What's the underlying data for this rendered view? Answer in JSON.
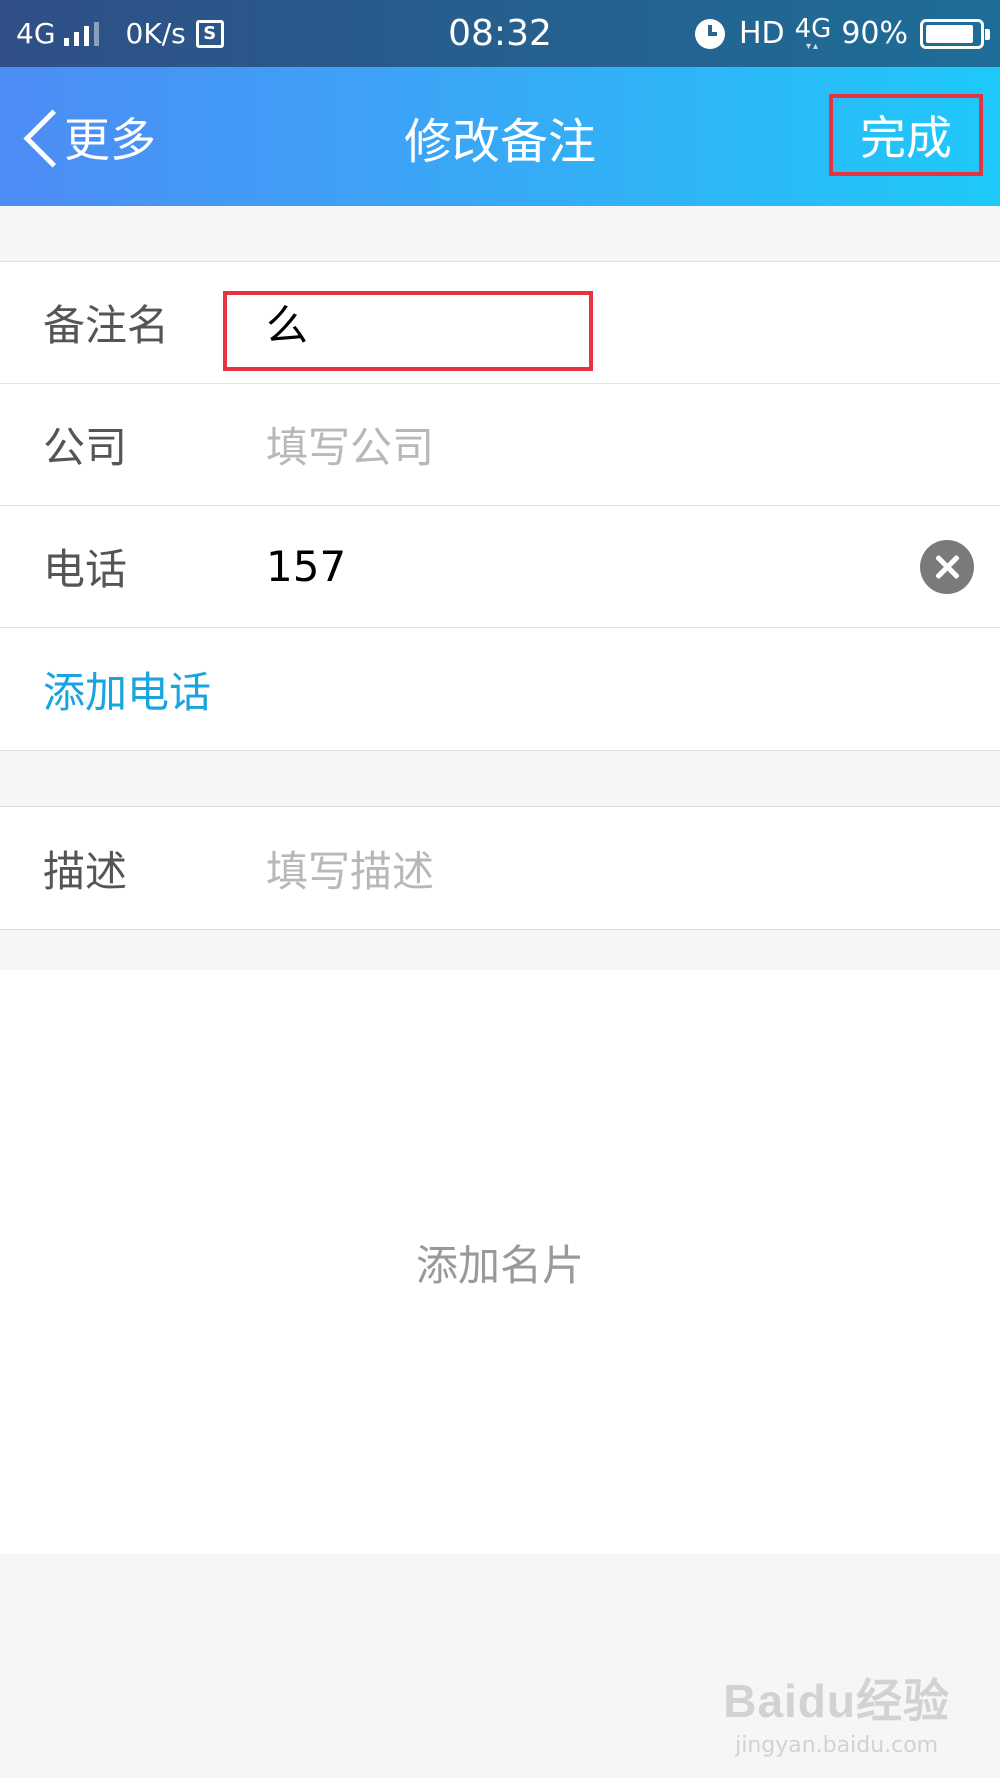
{
  "status_bar": {
    "network": "4G",
    "speed": "0K/s",
    "s_icon_letter": "S",
    "time": "08:32",
    "hd": "HD",
    "net_right": "4G",
    "battery_text": "90%",
    "battery_level": 0.9
  },
  "nav": {
    "back_label": "更多",
    "title": "修改备注",
    "done_label": "完成"
  },
  "form": {
    "remark": {
      "label": "备注名",
      "value": "么"
    },
    "company": {
      "label": "公司",
      "placeholder": "填写公司"
    },
    "phone": {
      "label": "电话",
      "value": "157"
    },
    "add_phone_label": "添加电话",
    "description": {
      "label": "描述",
      "placeholder": "填写描述"
    }
  },
  "card": {
    "label": "添加名片"
  },
  "watermark": {
    "logo": "Baidu经验",
    "url": "jingyan.baidu.com"
  },
  "colors": {
    "nav_gradient_start": "#4d8cf5",
    "nav_gradient_end": "#1ec9fa",
    "highlight_border": "#e53340",
    "link_blue": "#17a4df",
    "background": "#f6f6f8"
  }
}
